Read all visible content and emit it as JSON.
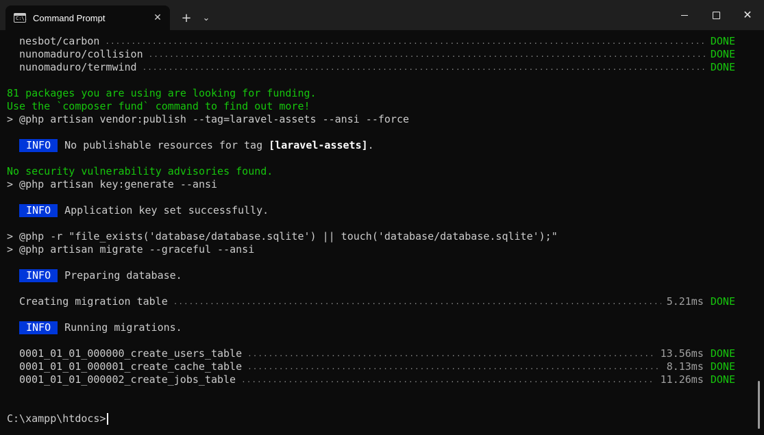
{
  "window": {
    "tab_title": "Command Prompt",
    "tab_icon_text": "C:\\.",
    "tab_close": "✕",
    "new_tab": "+",
    "dropdown": "⌄",
    "close_glyph": "✕"
  },
  "terminal": {
    "packages": [
      {
        "name": "nesbot/carbon",
        "status": "DONE"
      },
      {
        "name": "nunomaduro/collision",
        "status": "DONE"
      },
      {
        "name": "nunomaduro/termwind",
        "status": "DONE"
      }
    ],
    "funding_line1": "81 packages you are using are looking for funding.",
    "funding_line2": "Use the `composer fund` command to find out more!",
    "cmd_vendor_publish": "> @php artisan vendor:publish --tag=laravel-assets --ansi --force",
    "info_label": "INFO",
    "info_no_resources_prefix": "No publishable resources for tag ",
    "info_no_resources_tag": "[laravel-assets]",
    "info_no_resources_suffix": ".",
    "security_line": "No security vulnerability advisories found.",
    "cmd_key_generate": "> @php artisan key:generate --ansi",
    "info_key_set": "Application key set successfully.",
    "cmd_file_exists": "> @php -r \"file_exists('database/database.sqlite') || touch('database/database.sqlite');\"",
    "cmd_migrate": "> @php artisan migrate --graceful --ansi",
    "info_preparing": "Preparing database.",
    "creating_table": {
      "name": "Creating migration table",
      "time": "5.21ms",
      "status": "DONE"
    },
    "info_running": "Running migrations.",
    "migrations": [
      {
        "name": "0001_01_01_000000_create_users_table",
        "time": "13.56ms",
        "status": "DONE"
      },
      {
        "name": "0001_01_01_000001_create_cache_table",
        "time": "8.13ms",
        "status": "DONE"
      },
      {
        "name": "0001_01_01_000002_create_jobs_table",
        "time": "11.26ms",
        "status": "DONE"
      }
    ],
    "prompt": "C:\\xampp\\htdocs>",
    "dots": "....................................................................................................................................................................................................................................................."
  }
}
